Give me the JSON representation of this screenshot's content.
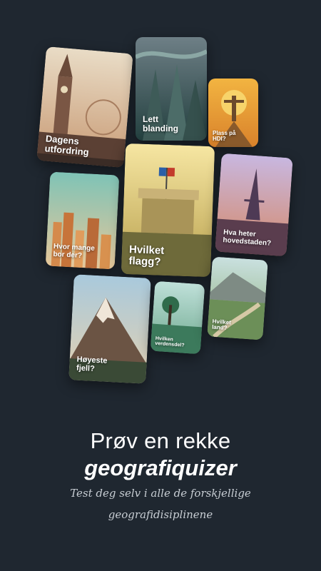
{
  "cards": [
    {
      "label": "Dagens\nutfordring"
    },
    {
      "label": "Lett\nblanding"
    },
    {
      "label": "Plass på\nHDI?"
    },
    {
      "label": "Hvor mange\nbor der?"
    },
    {
      "label": "Hvilket\nflagg?"
    },
    {
      "label": "Hva heter\nhovedstaden?"
    },
    {
      "label": "Høyeste\nfjell?"
    },
    {
      "label": "Hvilken\nverdensdel?"
    },
    {
      "label": "Hvilket\nland?"
    }
  ],
  "headline": {
    "line1": "Prøv en rekke",
    "line2": "geografiquizer",
    "subtitle": "Test deg selv i alle de forskjellige geografidisiplinene"
  }
}
